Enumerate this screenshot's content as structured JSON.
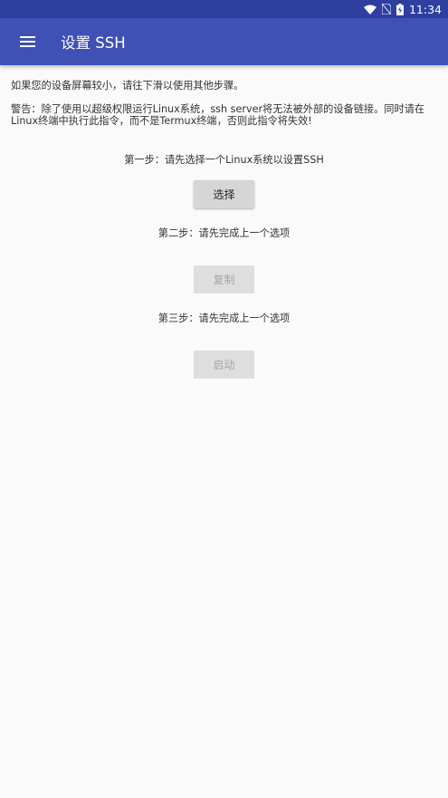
{
  "status_bar": {
    "time": "11:34",
    "icons": [
      "wifi-icon",
      "no-sim-icon",
      "battery-charging-icon"
    ]
  },
  "app_bar": {
    "menu_icon": "hamburger-menu-icon",
    "title": "设置 SSH"
  },
  "notes": {
    "small_screen": "如果您的设备屏幕较小，请往下滑以使用其他步骤。",
    "warning_line1": "警告：除了使用以超级权限运行Linux系统，ssh server将无法被外部的设备链接。同时请在",
    "warning_line2": "Linux终端中执行此指令，而不是Termux终端，否则此指令将失效!"
  },
  "steps": [
    {
      "text": "第一步：请先选择一个Linux系统以设置SSH",
      "button": "选择",
      "enabled": true
    },
    {
      "text": "第二步：请先完成上一个选项",
      "button": "复制",
      "enabled": false
    },
    {
      "text": "第三步：请先完成上一个选项",
      "button": "启动",
      "enabled": false
    }
  ],
  "colors": {
    "app_bar": "#3f51b5",
    "status_bar": "#2f3fa0",
    "background": "#fafafa"
  }
}
